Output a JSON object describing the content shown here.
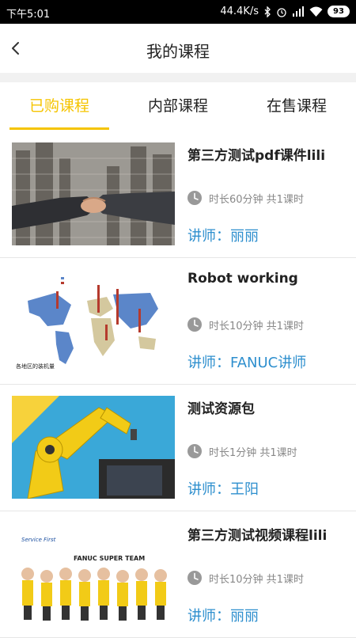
{
  "status_bar": {
    "time": "下午5:01",
    "network_speed": "44.4K/s",
    "battery": "93",
    "icons": [
      "bluetooth-icon",
      "alarm-icon",
      "signal-icon",
      "wifi-icon",
      "battery-icon"
    ]
  },
  "header": {
    "title": "我的课程",
    "back_icon": "chevron-left-icon"
  },
  "tabs": [
    {
      "label": "已购课程",
      "active": true
    },
    {
      "label": "内部课程",
      "active": false
    },
    {
      "label": "在售课程",
      "active": false
    }
  ],
  "courses": [
    {
      "title": "第三方测试pdf课件lili",
      "meta": "时长60分钟 共1课时",
      "teacher": "讲师：丽丽",
      "thumbnail": "handshake-city-image"
    },
    {
      "title": "Robot working",
      "meta": "时长10分钟 共1课时",
      "teacher": "讲师：FANUC讲师",
      "thumbnail": "world-map-image",
      "thumbnail_caption": "各地区的装机量"
    },
    {
      "title": "测试资源包",
      "meta": "时长1分钟 共1课时",
      "teacher": "讲师：王阳",
      "thumbnail": "yellow-robot-arm-image"
    },
    {
      "title": "第三方测试视频课程lili",
      "meta": "时长10分钟 共1课时",
      "teacher": "讲师：丽丽",
      "thumbnail": "fanuc-team-image",
      "thumbnail_text": [
        "Service First",
        "FANUC SUPER TEAM"
      ]
    }
  ],
  "colors": {
    "accent": "#f5c400",
    "teacher": "#2e8fce",
    "meta": "#888888",
    "divider": "#f1f1f1"
  }
}
